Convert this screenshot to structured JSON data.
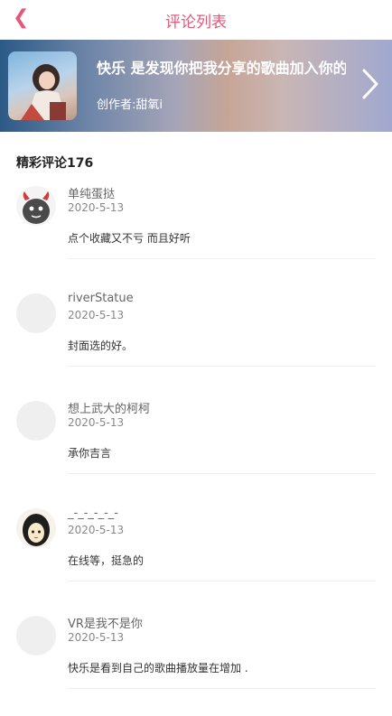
{
  "nav": {
    "back_icon": "chevron-left-icon",
    "title": "评论列表"
  },
  "playlist": {
    "name": "快乐 是发现你把我分享的歌曲加入你的歌单",
    "creator": "创作者:甜氧i",
    "arrow_icon": "chevron-right-icon"
  },
  "section": {
    "title": "精彩评论176"
  },
  "comments": [
    {
      "name": "单纯蛋挞",
      "date": "2020-5-13",
      "text": "点个收藏又不亏 而且好听",
      "avatar": "monster"
    },
    {
      "name": "riverStatue",
      "date": "2020-5-13",
      "text": "封面选的好。",
      "avatar": "blank"
    },
    {
      "name": "想上武大的柯柯",
      "date": "2020-5-13",
      "text": "承你吉言",
      "avatar": "blank"
    },
    {
      "name": "_-_-_-_-_-",
      "date": "2020-5-13",
      "text": "在线等，挺急的",
      "avatar": "cartoon-girl"
    },
    {
      "name": "VR是我不是你",
      "date": "2020-5-13",
      "text": "快乐是看到自己的歌曲播放量在增加 .",
      "avatar": "blank"
    }
  ],
  "colors": {
    "accent": "#e2597c"
  }
}
